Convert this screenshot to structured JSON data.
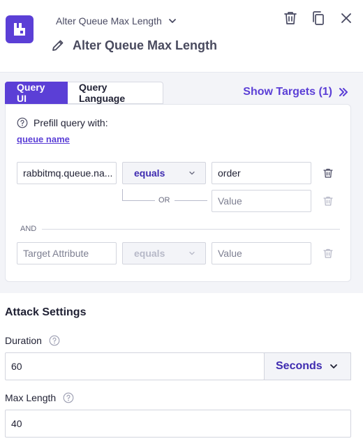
{
  "header": {
    "breadcrumb_label": "Alter Queue Max Length",
    "title": "Alter Queue Max Length",
    "icons": [
      "rabbitmq-logo-icon",
      "chevron-down-icon",
      "pencil-icon",
      "trash-icon",
      "copy-icon",
      "close-icon"
    ]
  },
  "query": {
    "tabs": [
      {
        "label": "Query UI",
        "active": true
      },
      {
        "label": "Query Language",
        "active": false
      }
    ],
    "show_targets": "Show Targets (1)",
    "prefill_label": "Prefill query with:",
    "prefill_link": "queue name",
    "rows": [
      {
        "attribute": "rabbitmq.queue.na...",
        "operator": "equals",
        "value": "order"
      },
      {
        "attribute": "",
        "operator": "",
        "value_placeholder": "Value"
      },
      {
        "attribute_placeholder": "Target Attribute",
        "operator": "equals",
        "value_placeholder": "Value"
      }
    ],
    "or_label": "OR",
    "and_label": "AND"
  },
  "attack_settings": {
    "heading": "Attack Settings",
    "duration_label": "Duration",
    "duration_value": "60",
    "duration_unit": "Seconds",
    "max_length_label": "Max Length",
    "max_length_value": "40"
  },
  "colors": {
    "accent": "#5b3fd6",
    "accent_text": "#3e2bb0",
    "section_bg": "#f3f4f8"
  }
}
